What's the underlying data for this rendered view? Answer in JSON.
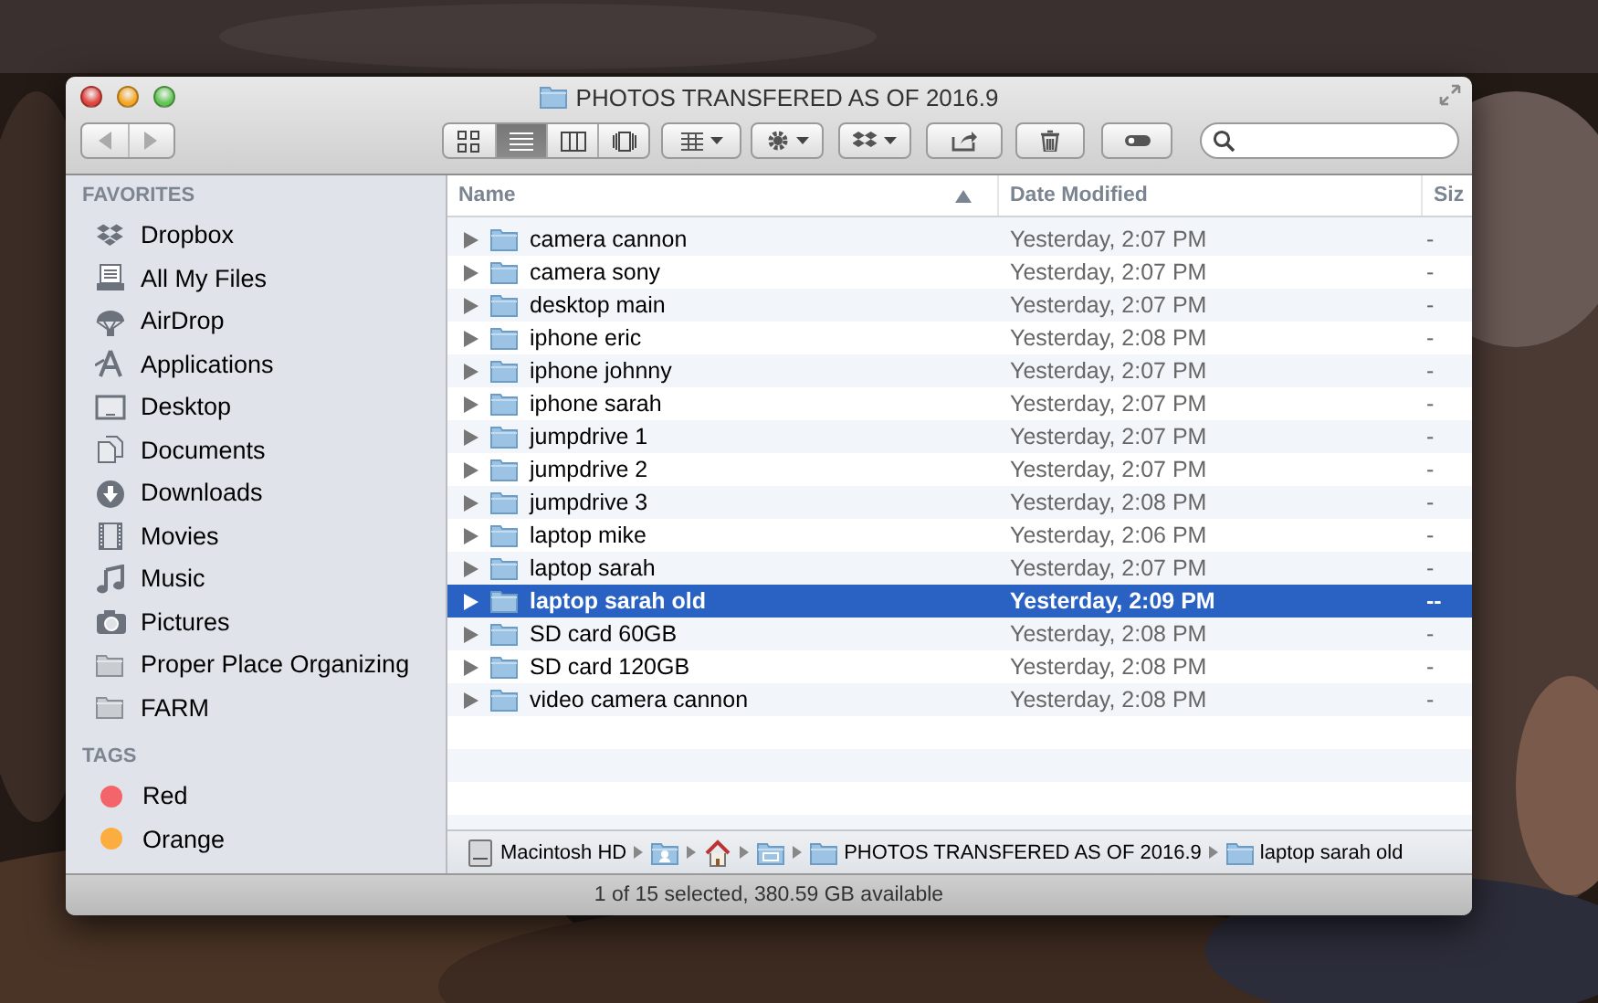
{
  "window": {
    "title": "PHOTOS TRANSFERED AS OF 2016.9"
  },
  "toolbar": {
    "view_modes": [
      {
        "selected": false
      },
      {
        "selected": true
      },
      {
        "selected": false
      },
      {
        "selected": false
      }
    ]
  },
  "sidebar": {
    "sections": [
      {
        "heading": "FAVORITES",
        "items": [
          {
            "label": "Dropbox",
            "kind": "dropbox"
          },
          {
            "label": "All My Files",
            "kind": "files"
          },
          {
            "label": "AirDrop",
            "kind": "airdrop"
          },
          {
            "label": "Applications",
            "kind": "apps"
          },
          {
            "label": "Desktop",
            "kind": "desktop"
          },
          {
            "label": "Documents",
            "kind": "documents"
          },
          {
            "label": "Downloads",
            "kind": "downloads"
          },
          {
            "label": "Movies",
            "kind": "movies"
          },
          {
            "label": "Music",
            "kind": "music"
          },
          {
            "label": "Pictures",
            "kind": "pictures"
          },
          {
            "label": "Proper Place Organizing",
            "kind": "folder"
          },
          {
            "label": "FARM",
            "kind": "folder"
          }
        ]
      },
      {
        "heading": "TAGS",
        "items": [
          {
            "label": "Red",
            "kind": "tag",
            "color": "#f4656b"
          },
          {
            "label": "Orange",
            "kind": "tag",
            "color": "#fbae3f"
          }
        ]
      }
    ]
  },
  "table": {
    "columns": [
      {
        "label": "Name",
        "sorted": true
      },
      {
        "label": "Date Modified",
        "sorted": false
      },
      {
        "label": "Siz",
        "sorted": false
      }
    ],
    "rows": [
      {
        "name": "camera cannon",
        "date": "Yesterday, 2:07 PM",
        "size": "-",
        "selected": false
      },
      {
        "name": "camera sony",
        "date": "Yesterday, 2:07 PM",
        "size": "-",
        "selected": false
      },
      {
        "name": "desktop main",
        "date": "Yesterday, 2:07 PM",
        "size": "-",
        "selected": false
      },
      {
        "name": "iphone eric",
        "date": "Yesterday, 2:08 PM",
        "size": "-",
        "selected": false
      },
      {
        "name": "iphone johnny",
        "date": "Yesterday, 2:07 PM",
        "size": "-",
        "selected": false
      },
      {
        "name": "iphone sarah",
        "date": "Yesterday, 2:07 PM",
        "size": "-",
        "selected": false
      },
      {
        "name": "jumpdrive 1",
        "date": "Yesterday, 2:07 PM",
        "size": "-",
        "selected": false
      },
      {
        "name": "jumpdrive 2",
        "date": "Yesterday, 2:07 PM",
        "size": "-",
        "selected": false
      },
      {
        "name": "jumpdrive 3",
        "date": "Yesterday, 2:08 PM",
        "size": "-",
        "selected": false
      },
      {
        "name": "laptop mike",
        "date": "Yesterday, 2:06 PM",
        "size": "-",
        "selected": false
      },
      {
        "name": "laptop sarah",
        "date": "Yesterday, 2:07 PM",
        "size": "-",
        "selected": false
      },
      {
        "name": "laptop sarah old",
        "date": "Yesterday, 2:09 PM",
        "size": "--",
        "selected": true
      },
      {
        "name": "SD card 60GB",
        "date": "Yesterday, 2:08 PM",
        "size": "-",
        "selected": false
      },
      {
        "name": "SD card 120GB",
        "date": "Yesterday, 2:08 PM",
        "size": "-",
        "selected": false
      },
      {
        "name": "video camera cannon",
        "date": "Yesterday, 2:08 PM",
        "size": "-",
        "selected": false
      }
    ]
  },
  "path_bar": [
    {
      "kind": "drive",
      "label": "Macintosh HD"
    },
    {
      "kind": "user-folder"
    },
    {
      "kind": "home"
    },
    {
      "kind": "plain-folder"
    },
    {
      "kind": "folder",
      "label": "PHOTOS TRANSFERED AS OF 2016.9"
    },
    {
      "kind": "folder",
      "label": "laptop sarah old"
    }
  ],
  "status_bar": "1 of 15 selected, 380.59 GB available"
}
